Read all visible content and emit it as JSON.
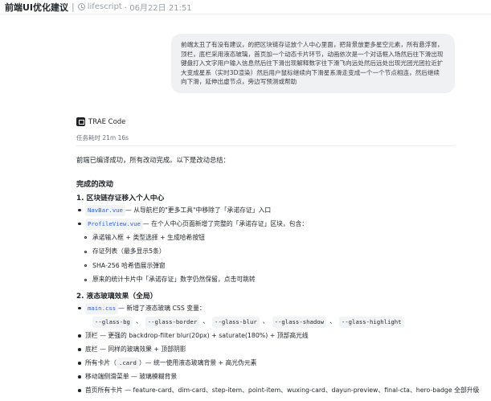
{
  "header": {
    "title": "前端UI优化建议",
    "separator": "|",
    "author": "lifescript",
    "datetime": "· 06月22日 21:51"
  },
  "user_message": "前端太丑了有没有建议，的把区块链存证放个人中心里面，把背景放更多星空元素，所有悬浮窗，顶栏，底栏采用液态玻璃，首页加一个动态卡片环节，动画依次是一个对话框入场然后往下滑出现键盘打入文字用户输入信息然后往下滑出现解释数字往下滑飞向远处然后远处出现光团光团拉近扩大变成星系（实时3D渲染）然后用户鼠标继续向下滑星系滑走变成一个一个节点相连，然后继续向下滑，延伸出虚节点，旁边写预测或帮助",
  "agent": {
    "name": "TRAE Code",
    "duration": "任务耗时 21m 16s"
  },
  "response": {
    "intro": "前端已编译成功，所有改动完成。以下是改动总结：",
    "heading": "完成的改动",
    "section1": {
      "title": "1. 区块链存证移入个人中心",
      "items": [
        {
          "code": "NavBar.vue",
          "text": " — 从导航栏的\"更多工具\"中移除了「承诺存证」入口"
        },
        {
          "code": "ProfileView.vue",
          "text": " — 在个人中心页面新增了完整的「承诺存证」区块，包含："
        }
      ],
      "subitems": [
        "承诺输入框 + 类型选择 + 生成哈希按钮",
        "存证列表（最多显示5条）",
        "SHA-256 哈希值展示弹窗",
        "原来的统计卡片中「承诺存证」数字仍然保留，点击可跳转"
      ]
    },
    "section2": {
      "title": "2. 液态玻璃效果（全局）",
      "css_item": {
        "code": "main.css",
        "text": " — 新增了液态玻璃 CSS 变量："
      },
      "css_vars": [
        "--glass-bg",
        "--glass-border",
        "--glass-blur",
        "--glass-shadow",
        "--glass-highlight"
      ],
      "var_separator": "、",
      "items": [
        "顶栏 — 更强的 backdrop-filter blur(20px) + saturate(180%) + 顶部高光线",
        "底栏 — 同样的玻璃效果 + 顶部阴影"
      ],
      "card_item": {
        "prefix": "所有卡片（",
        "code": ".card",
        "suffix": "）— 统一使用液态玻璃背景 + 高光伪元素"
      },
      "items2": [
        "移动端侧滑菜单 — 玻璃模糊背景",
        "首页所有卡片 — feature-card、dim-card、step-item、point-item、wuxing-card、dayun-preview、final-cta、hero-badge 全部升级"
      ]
    }
  }
}
